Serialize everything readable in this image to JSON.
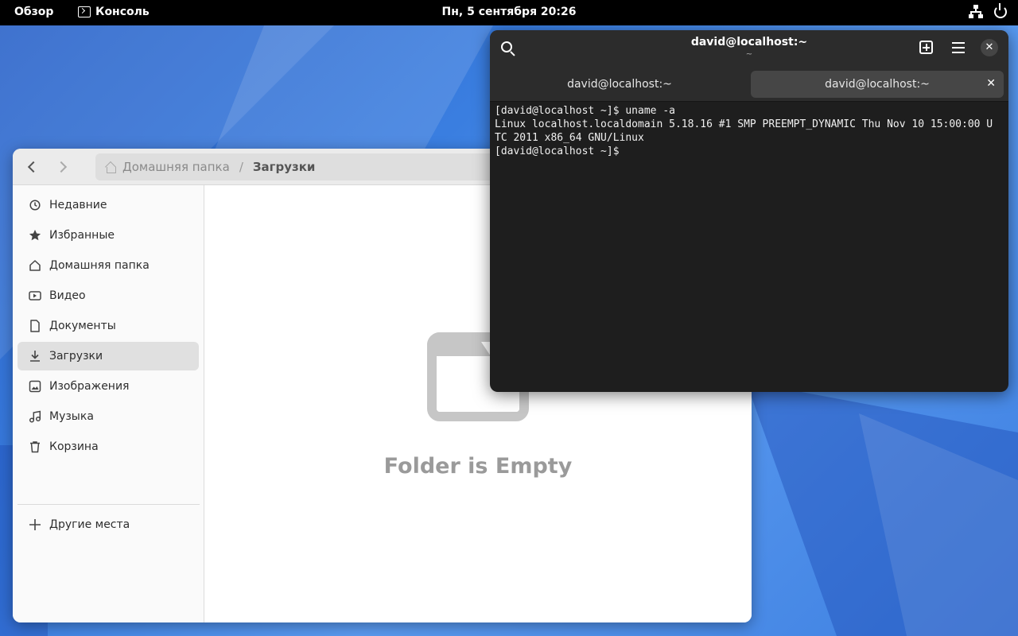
{
  "topbar": {
    "overview": "Обзор",
    "app_name": "Консоль",
    "clock": "Пн, 5 сентября  20:26",
    "icons": [
      "network-icon",
      "power-icon"
    ]
  },
  "files": {
    "path": {
      "home": "Домашняя папка",
      "separator": "/",
      "current": "Загрузки"
    },
    "sidebar": {
      "items": [
        {
          "label": "Недавние",
          "icon": "clock-icon"
        },
        {
          "label": "Избранные",
          "icon": "star-icon"
        },
        {
          "label": "Домашняя папка",
          "icon": "home-icon"
        },
        {
          "label": "Видео",
          "icon": "video-icon"
        },
        {
          "label": "Документы",
          "icon": "document-icon"
        },
        {
          "label": "Загрузки",
          "icon": "download-icon",
          "active": true
        },
        {
          "label": "Изображения",
          "icon": "image-icon"
        },
        {
          "label": "Музыка",
          "icon": "music-icon"
        },
        {
          "label": "Корзина",
          "icon": "trash-icon"
        }
      ],
      "other_places": "Другие места"
    },
    "empty_message": "Folder is Empty"
  },
  "terminal": {
    "title": "david@localhost:~",
    "subtitle": "~",
    "tabs": [
      {
        "label": "david@localhost:~"
      },
      {
        "label": "david@localhost:~",
        "active": true
      }
    ],
    "close_glyph": "✕",
    "lines": [
      "[david@localhost ~]$ uname -a",
      "Linux localhost.localdomain 5.18.16 #1 SMP PREEMPT_DYNAMIC Thu Nov 10 15:00:00 U",
      "TC 2011 x86_64 GNU/Linux",
      "[david@localhost ~]$ "
    ]
  }
}
